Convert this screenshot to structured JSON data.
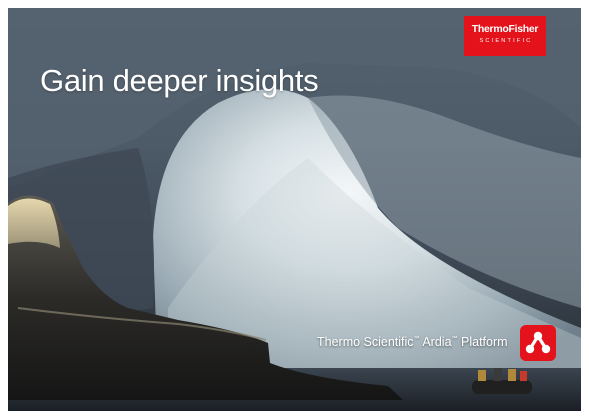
{
  "headline": "Gain deeper insights",
  "logo": {
    "main": "ThermoFisher",
    "sub": "SCIENTIFIC"
  },
  "platform": {
    "brand": "Thermo Scientific",
    "tm1": "™",
    "product": " Ardia",
    "tm2": "™",
    "suffix": " Platform"
  },
  "icons": {
    "brand": "thermofisher-logo",
    "app": "ardia-network-icon",
    "scene": "ice-cave-photo"
  },
  "colors": {
    "brand_red": "#e3121b",
    "text": "#ffffff"
  }
}
